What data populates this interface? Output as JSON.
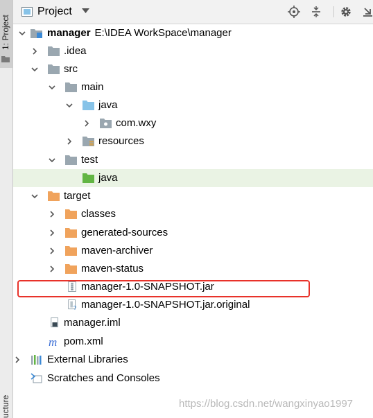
{
  "sidebar": {
    "project_tab_label": "1: Project",
    "structure_tab_label": "ucture"
  },
  "header": {
    "title": "Project",
    "buttons": [
      "locate-icon",
      "collapse-all-icon",
      "settings-icon",
      "hide-icon"
    ]
  },
  "tree": {
    "root_name": "manager",
    "root_path": "E:\\IDEA WorkSpace\\manager",
    "idea": ".idea",
    "src": "src",
    "main": "main",
    "main_java": "java",
    "package": "com.wxy",
    "resources": "resources",
    "test": "test",
    "test_java": "java",
    "target": "target",
    "classes": "classes",
    "generated_sources": "generated-sources",
    "maven_archiver": "maven-archiver",
    "maven_status": "maven-status",
    "jar": "manager-1.0-SNAPSHOT.jar",
    "jar_original": "manager-1.0-SNAPSHOT.jar.original",
    "iml": "manager.iml",
    "pom": "pom.xml",
    "external_libraries": "External Libraries",
    "scratches": "Scratches and Consoles"
  },
  "colors": {
    "folder_gray": "#9aa7b0",
    "folder_source": "#87c3e8",
    "folder_test": "#62b543",
    "folder_excluded": "#f0a35c",
    "selection": "#eaf3e4",
    "highlight_box": "#e8322a"
  },
  "watermark": "https://blog.csdn.net/wangxinyao1997"
}
